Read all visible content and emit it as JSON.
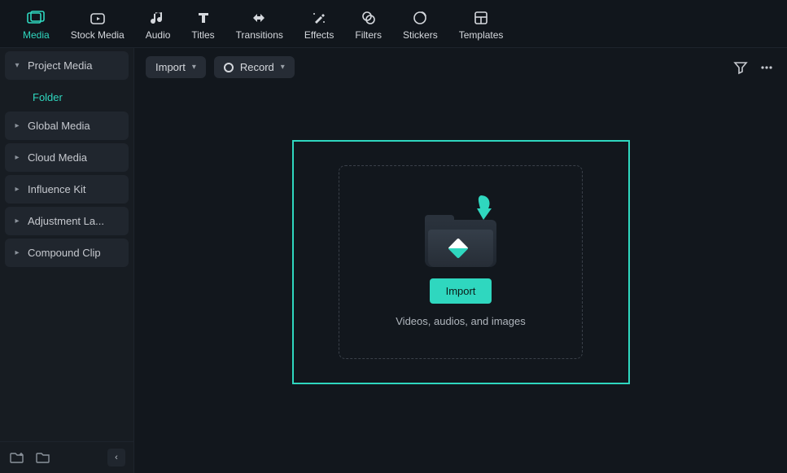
{
  "topTabs": [
    {
      "label": "Media",
      "active": true
    },
    {
      "label": "Stock Media"
    },
    {
      "label": "Audio"
    },
    {
      "label": "Titles"
    },
    {
      "label": "Transitions"
    },
    {
      "label": "Effects"
    },
    {
      "label": "Filters"
    },
    {
      "label": "Stickers"
    },
    {
      "label": "Templates"
    }
  ],
  "sidebar": {
    "items": [
      {
        "label": "Project Media",
        "expanded": true
      },
      {
        "label": "Global Media"
      },
      {
        "label": "Cloud Media"
      },
      {
        "label": "Influence Kit"
      },
      {
        "label": "Adjustment La..."
      },
      {
        "label": "Compound Clip"
      }
    ],
    "subItem": "Folder"
  },
  "contentToolbar": {
    "importLabel": "Import",
    "recordLabel": "Record"
  },
  "dropZone": {
    "buttonLabel": "Import",
    "hint": "Videos, audios, and images"
  },
  "colors": {
    "accent": "#2fd7bf"
  }
}
